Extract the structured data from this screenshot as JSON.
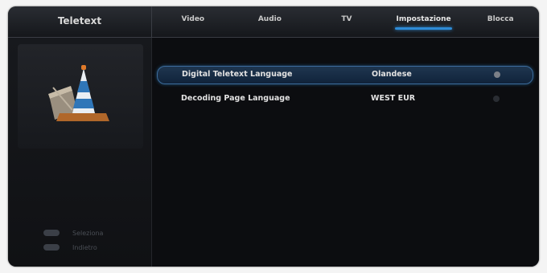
{
  "header": {
    "section_title": "Teletext",
    "tabs": [
      {
        "label": "Video",
        "active": false
      },
      {
        "label": "Audio",
        "active": false
      },
      {
        "label": "TV",
        "active": false
      },
      {
        "label": "Impostazione",
        "active": true
      },
      {
        "label": "Blocca",
        "active": false
      }
    ]
  },
  "settings": [
    {
      "label": "Digital Teletext Language",
      "value": "Olandese",
      "selected": true
    },
    {
      "label": "Decoding Page Language",
      "value": "WEST EUR",
      "selected": false
    }
  ],
  "sidebar": {
    "icon": "traffic-cone-icon",
    "legend": [
      {
        "key": "ok-key-icon",
        "text": "Seleziona"
      },
      {
        "key": "exit-key-icon",
        "text": "Indietro"
      }
    ]
  },
  "colors": {
    "accent": "#2e8bd6",
    "background": "#0b0c0f",
    "text": "#e2e2e2"
  }
}
